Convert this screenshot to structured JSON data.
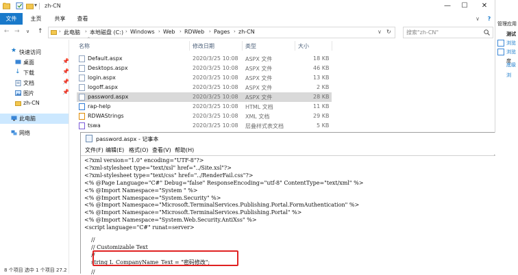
{
  "explorer": {
    "title": "zh-CN",
    "window_controls": [
      "—",
      "☐",
      "✕"
    ],
    "ribbon_tabs": [
      "文件",
      "主页",
      "共享",
      "查看"
    ],
    "nav_buttons": [
      "←",
      "→",
      "∨",
      "↑"
    ],
    "breadcrumb": [
      "此电脑",
      "本地磁盘 (C:)",
      "Windows",
      "Web",
      "RDWeb",
      "Pages",
      "zh-CN"
    ],
    "search_placeholder": "搜索\"zh-CN\"",
    "sidebar": [
      {
        "label": "快速访问",
        "pinned": false
      },
      {
        "label": "桌面",
        "pinned": true
      },
      {
        "label": "下载",
        "pinned": true
      },
      {
        "label": "文档",
        "pinned": true
      },
      {
        "label": "图片",
        "pinned": true
      },
      {
        "label": "zh-CN",
        "pinned": false
      },
      {
        "label": "此电脑",
        "pinned": false
      },
      {
        "label": "网络",
        "pinned": false
      }
    ],
    "pin_glyph": "📌",
    "columns": [
      "名称",
      "修改日期",
      "类型",
      "大小"
    ],
    "files": [
      {
        "name": "Default.aspx",
        "date": "2020/3/25 10:08",
        "type": "ASPX 文件",
        "size": "18 KB"
      },
      {
        "name": "Desktops.aspx",
        "date": "2020/3/25 10:08",
        "type": "ASPX 文件",
        "size": "46 KB"
      },
      {
        "name": "login.aspx",
        "date": "2020/3/25 10:08",
        "type": "ASPX 文件",
        "size": "13 KB"
      },
      {
        "name": "logoff.aspx",
        "date": "2020/3/25 10:08",
        "type": "ASPX 文件",
        "size": "2 KB"
      },
      {
        "name": "password.aspx",
        "date": "2020/3/25 10:08",
        "type": "ASPX 文件",
        "size": "28 KB"
      },
      {
        "name": "rap-help",
        "date": "2020/3/25 10:08",
        "type": "HTML 文档",
        "size": "11 KB"
      },
      {
        "name": "RDWAStrings",
        "date": "2020/3/25 10:08",
        "type": "XML 文档",
        "size": "29 KB"
      },
      {
        "name": "tswa",
        "date": "2020/3/25 10:08",
        "type": "层叠样式表文档",
        "size": "5 KB"
      }
    ],
    "status_text": "8 个项目   选中 1 个项目 27.2"
  },
  "right_panel": {
    "items": [
      "管理应用",
      "测试",
      "浏览",
      "浏览",
      "度",
      "底级",
      "浏"
    ]
  },
  "notepad": {
    "title": "password.aspx - 记事本",
    "menu": [
      "文件(F)",
      "编辑(E)",
      "格式(O)",
      "查看(V)",
      "帮助(H)"
    ],
    "lines": [
      "<?xml version=\"1.0\" encoding=\"UTF-8\"?>",
      "<?xml-stylesheet type=\"text/xsl\" href=\"../Site.xsl\"?>",
      "<?xml-stylesheet type=\"text/css\" href=\"../RenderFail.css\"?>",
      "<% @Page Language=\"C#\" Debug=\"false\" ResponseEncoding=\"utf-8\" ContentType=\"text/xml\" %>",
      "<% @Import Namespace=\"System \" %>",
      "<% @Import Namespace=\"System.Security\" %>",
      "<% @Import Namespace=\"Microsoft.TerminalServices.Publishing.Portal.FormAuthentication\" %>",
      "<% @Import Namespace=\"Microsoft.TerminalServices.Publishing.Portal\" %>",
      "<% @Import Namespace=\"System.Web.Security.AntiXss\" %>",
      "<script language=\"C#\" runat=server>",
      "",
      "    //",
      "    // Customizable Text",
      "    //",
      "    string L_CompanyName_Text = \"密码修改\";",
      "",
      "    //"
    ]
  },
  "colors": {
    "accent": "#1979ca",
    "selection": "#cce8ff",
    "highlight_box": "#e02020"
  }
}
